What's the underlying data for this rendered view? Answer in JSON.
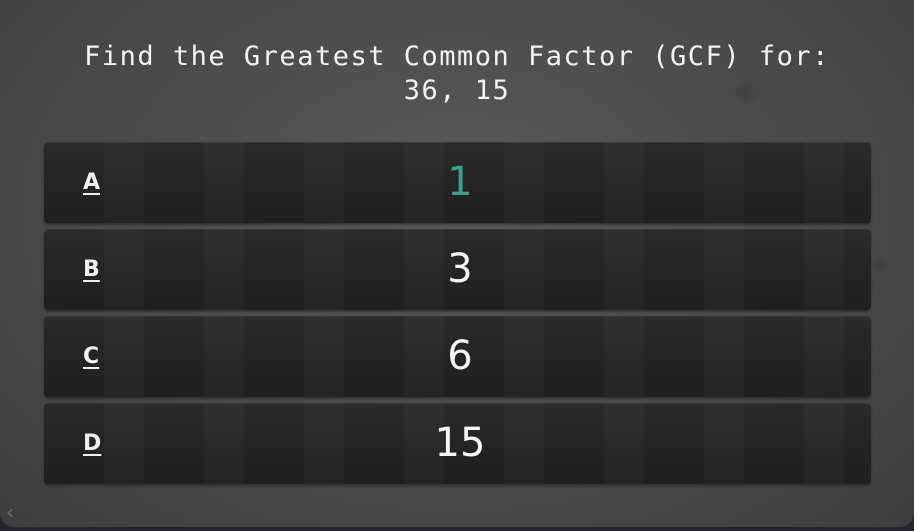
{
  "question": {
    "line1": "Find the Greatest Common Factor (GCF) for:",
    "line2": "36, 15"
  },
  "answers": [
    {
      "letter": "A",
      "value": "1"
    },
    {
      "letter": "B",
      "value": "3"
    },
    {
      "letter": "C",
      "value": "6"
    },
    {
      "letter": "D",
      "value": "15"
    }
  ],
  "back_icon": "chevron-left-icon",
  "colors": {
    "highlight": "#3aa08e",
    "text": "#f2f2f2",
    "answer_bg": "#242424",
    "board_bg": "#4a4a4a"
  }
}
